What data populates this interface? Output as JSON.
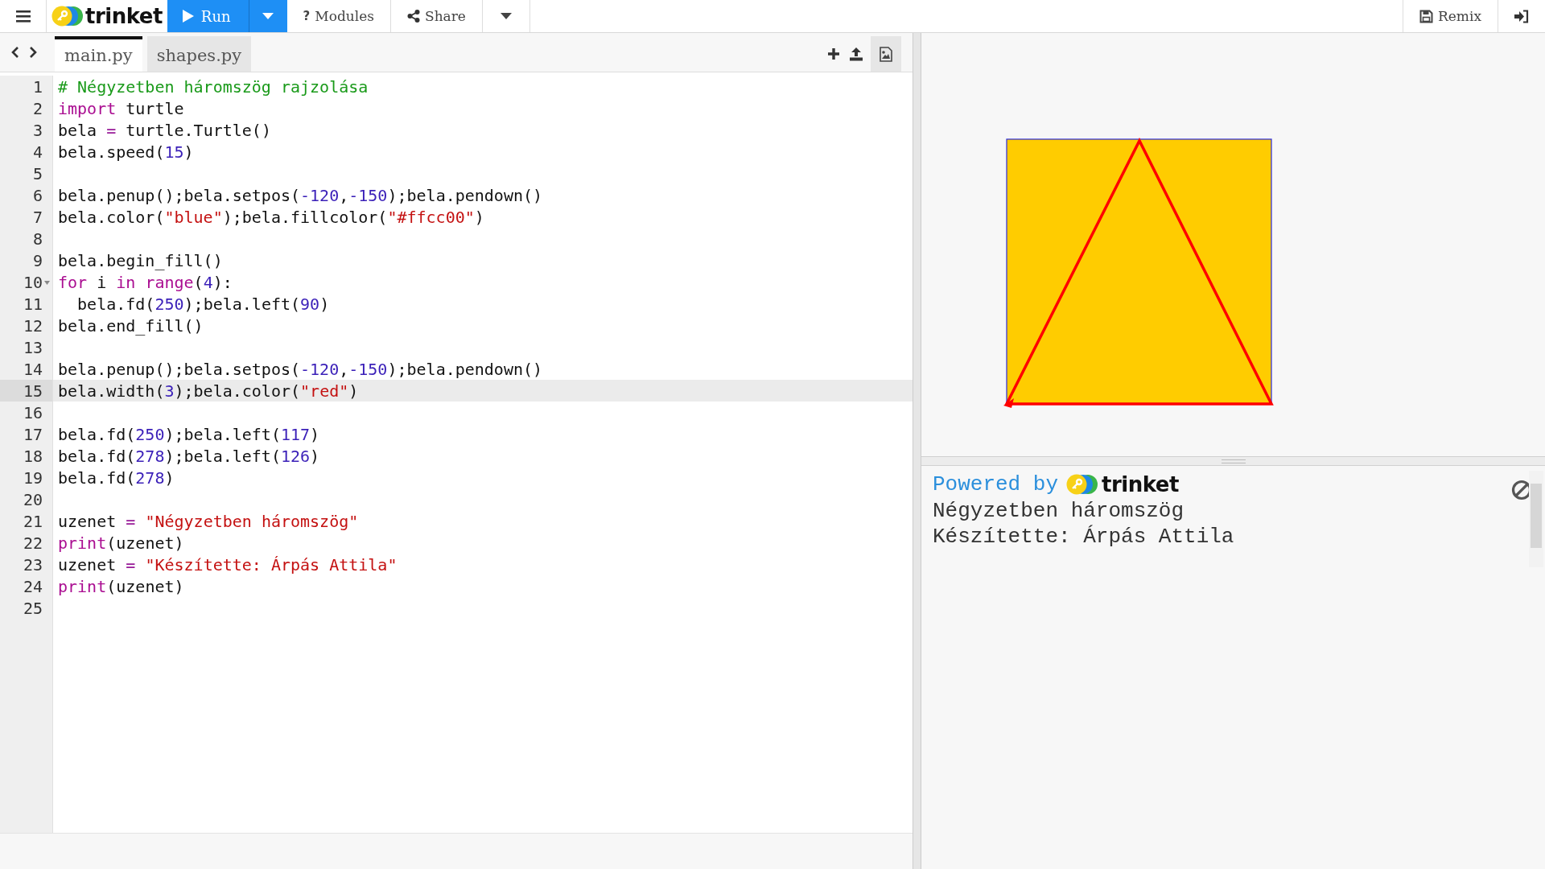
{
  "toolbar": {
    "logo": "trinket",
    "run": "Run",
    "modules_icon": "?",
    "modules": "Modules",
    "share": "Share",
    "remix": "Remix"
  },
  "file_tabs": [
    {
      "label": "main.py",
      "selected": true
    },
    {
      "label": "shapes.py",
      "selected": false
    }
  ],
  "editor": {
    "lines": [
      {
        "number": "1",
        "selected": false,
        "foldable": false,
        "tokens": [
          {
            "kind": "comment",
            "text": "# Négyzetben háromszög rajzolása"
          }
        ]
      },
      {
        "number": "2",
        "selected": false,
        "foldable": false,
        "tokens": [
          {
            "kind": "keyword",
            "text": "import"
          },
          {
            "kind": "plain",
            "text": " turtle"
          }
        ]
      },
      {
        "number": "3",
        "selected": false,
        "foldable": false,
        "tokens": [
          {
            "kind": "plain",
            "text": "bela "
          },
          {
            "kind": "operator",
            "text": "="
          },
          {
            "kind": "plain",
            "text": " turtle.Turtle()"
          }
        ]
      },
      {
        "number": "4",
        "selected": false,
        "foldable": false,
        "tokens": [
          {
            "kind": "plain",
            "text": "bela.speed("
          },
          {
            "kind": "number",
            "text": "15"
          },
          {
            "kind": "plain",
            "text": ")"
          }
        ]
      },
      {
        "number": "5",
        "selected": false,
        "foldable": false
      },
      {
        "number": "6",
        "selected": false,
        "foldable": false,
        "tokens": [
          {
            "kind": "plain",
            "text": "bela.penup();bela.setpos("
          },
          {
            "kind": "number",
            "text": "-120"
          },
          {
            "kind": "plain",
            "text": ","
          },
          {
            "kind": "number",
            "text": "-150"
          },
          {
            "kind": "plain",
            "text": ");bela.pendown()"
          }
        ]
      },
      {
        "number": "7",
        "selected": false,
        "foldable": false,
        "tokens": [
          {
            "kind": "plain",
            "text": "bela.color("
          },
          {
            "kind": "string",
            "text": "\"blue\""
          },
          {
            "kind": "plain",
            "text": ");bela.fillcolor("
          },
          {
            "kind": "string",
            "text": "\"#ffcc00\""
          },
          {
            "kind": "plain",
            "text": ")"
          }
        ]
      },
      {
        "number": "8",
        "selected": false,
        "foldable": false
      },
      {
        "number": "9",
        "selected": false,
        "foldable": false,
        "tokens": [
          {
            "kind": "plain",
            "text": "bela.begin_fill()"
          }
        ]
      },
      {
        "number": "10",
        "selected": false,
        "foldable": true,
        "tokens": [
          {
            "kind": "keyword",
            "text": "for"
          },
          {
            "kind": "plain",
            "text": " i "
          },
          {
            "kind": "keyword",
            "text": "in"
          },
          {
            "kind": "builtin",
            "text": " range"
          },
          {
            "kind": "plain",
            "text": "("
          },
          {
            "kind": "number",
            "text": "4"
          },
          {
            "kind": "plain",
            "text": "):"
          }
        ]
      },
      {
        "number": "11",
        "selected": false,
        "foldable": false,
        "tokens": [
          {
            "kind": "plain",
            "text": "  bela.fd("
          },
          {
            "kind": "number",
            "text": "250"
          },
          {
            "kind": "plain",
            "text": ");bela.left("
          },
          {
            "kind": "number",
            "text": "90"
          },
          {
            "kind": "plain",
            "text": ")"
          }
        ]
      },
      {
        "number": "12",
        "selected": false,
        "foldable": false,
        "tokens": [
          {
            "kind": "plain",
            "text": "bela.end_fill()"
          }
        ]
      },
      {
        "number": "13",
        "selected": false,
        "foldable": false
      },
      {
        "number": "14",
        "selected": false,
        "foldable": false,
        "tokens": [
          {
            "kind": "plain",
            "text": "bela.penup();bela.setpos("
          },
          {
            "kind": "number",
            "text": "-120"
          },
          {
            "kind": "plain",
            "text": ","
          },
          {
            "kind": "number",
            "text": "-150"
          },
          {
            "kind": "plain",
            "text": ");bela.pendown()"
          }
        ]
      },
      {
        "number": "15",
        "selected": true,
        "foldable": false,
        "tokens": [
          {
            "kind": "plain",
            "text": "bela.width("
          },
          {
            "kind": "number",
            "text": "3"
          },
          {
            "kind": "plain",
            "text": ");bela.color("
          },
          {
            "kind": "string",
            "text": "\"red\""
          },
          {
            "kind": "plain",
            "text": ")"
          }
        ]
      },
      {
        "number": "16",
        "selected": false,
        "foldable": false
      },
      {
        "number": "17",
        "selected": false,
        "foldable": false,
        "tokens": [
          {
            "kind": "plain",
            "text": "bela.fd("
          },
          {
            "kind": "number",
            "text": "250"
          },
          {
            "kind": "plain",
            "text": ");bela.left("
          },
          {
            "kind": "number",
            "text": "117"
          },
          {
            "kind": "plain",
            "text": ")"
          }
        ]
      },
      {
        "number": "18",
        "selected": false,
        "foldable": false,
        "tokens": [
          {
            "kind": "plain",
            "text": "bela.fd("
          },
          {
            "kind": "number",
            "text": "278"
          },
          {
            "kind": "plain",
            "text": ");bela.left("
          },
          {
            "kind": "number",
            "text": "126"
          },
          {
            "kind": "plain",
            "text": ")"
          }
        ]
      },
      {
        "number": "19",
        "selected": false,
        "foldable": false,
        "tokens": [
          {
            "kind": "plain",
            "text": "bela.fd("
          },
          {
            "kind": "number",
            "text": "278"
          },
          {
            "kind": "plain",
            "text": ")"
          }
        ]
      },
      {
        "number": "20",
        "selected": false,
        "foldable": false
      },
      {
        "number": "21",
        "selected": false,
        "foldable": false,
        "tokens": [
          {
            "kind": "plain",
            "text": "uzenet "
          },
          {
            "kind": "operator",
            "text": "="
          },
          {
            "kind": "string",
            "text": " \"Négyzetben háromszög\""
          }
        ]
      },
      {
        "number": "22",
        "selected": false,
        "foldable": false,
        "tokens": [
          {
            "kind": "builtin",
            "text": "print"
          },
          {
            "kind": "plain",
            "text": "(uzenet)"
          }
        ]
      },
      {
        "number": "23",
        "selected": false,
        "foldable": false,
        "tokens": [
          {
            "kind": "plain",
            "text": "uzenet "
          },
          {
            "kind": "operator",
            "text": "="
          },
          {
            "kind": "string",
            "text": " \"Készítette: Árpás Attila\""
          }
        ]
      },
      {
        "number": "24",
        "selected": false,
        "foldable": false,
        "tokens": [
          {
            "kind": "builtin",
            "text": "print"
          },
          {
            "kind": "plain",
            "text": "(uzenet)"
          }
        ]
      },
      {
        "number": "25",
        "selected": false,
        "foldable": false
      }
    ]
  },
  "output": {
    "powered_by": "Powered by",
    "logo": "trinket",
    "lines": [
      "Négyzetben háromszög",
      "Készítette: Árpás Attila"
    ]
  }
}
